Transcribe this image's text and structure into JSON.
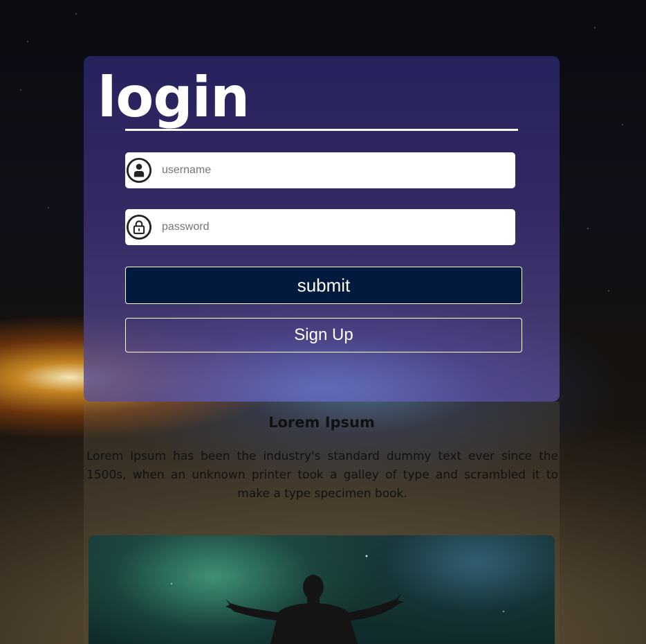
{
  "login": {
    "title": "login",
    "username_placeholder": "username",
    "password_placeholder": "password",
    "submit_label": "submit",
    "signup_label": "Sign Up"
  },
  "icons": {
    "username": "user-circle-icon",
    "password": "lock-circle-icon"
  },
  "info": {
    "title": "Lorem Ipsum",
    "text": "Lorem Ipsum has been the industry's standard dummy text ever since the 1500s, when an unknown printer took a galley of type and scrambled it to make a type specimen book."
  },
  "colors": {
    "submit_bg": "#021a3e",
    "card_bg": "#2a2766",
    "text_light": "#ffffff"
  }
}
